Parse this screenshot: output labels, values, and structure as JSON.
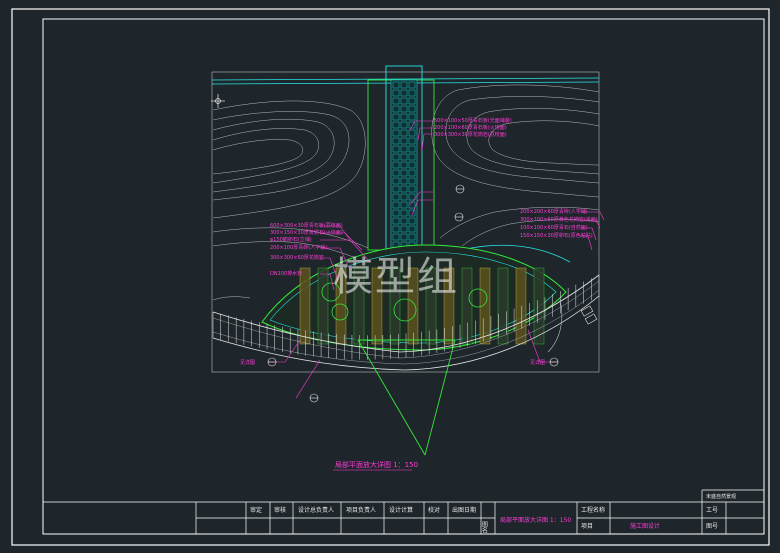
{
  "drawing": {
    "watermark": "模型组",
    "plan_caption": "局部平面放大详图 1：150",
    "callouts_top_right": [
      "500×100×50厚青石板(光面铺装)",
      "200×100×60厚青石板(火烧面)",
      "300×300×30厚花岗岩(荔枝面)"
    ],
    "callouts_right": [
      "200×200×60厚青砖(人字铺)",
      "300×100×60厚黄色花岗岩(光面)",
      "100×100×60厚青石(自然面)",
      "150×150×30厚卵石(原色粘贴)"
    ],
    "callouts_left": [
      "600×300×30厚青石板(荔枝面)",
      "300×150×30厚黄锈石(火烧面)",
      "φ150鹅卵石(立铺)",
      "200×100厚青砖(人字铺)",
      "300×300×60厚花岗岩",
      "DN100排水管"
    ],
    "callout_bottom_right": "见详图",
    "callout_bottom_left": "见详图"
  },
  "title_block": {
    "company": "未盛自然景观",
    "cells": [
      "审定",
      "审核",
      "设计总负责人",
      "项目负责人",
      "设计计算",
      "校对",
      "出图日期"
    ],
    "label_tu_ming": "图名",
    "drawing_name": "局部平面放大详图 1：150",
    "project_label": "工程名称",
    "project_item_label": "项目",
    "project_value": "施工图设计",
    "job_no_label": "工号",
    "drawing_no_label": "图号"
  },
  "colors": {
    "background": "#1f262b",
    "frame": "#ffffff",
    "cyan": "#27e6e6",
    "green": "#34e83a",
    "magenta": "#ff3bd8",
    "yellow": "#e3d24a",
    "gray": "#b8bcbf"
  }
}
